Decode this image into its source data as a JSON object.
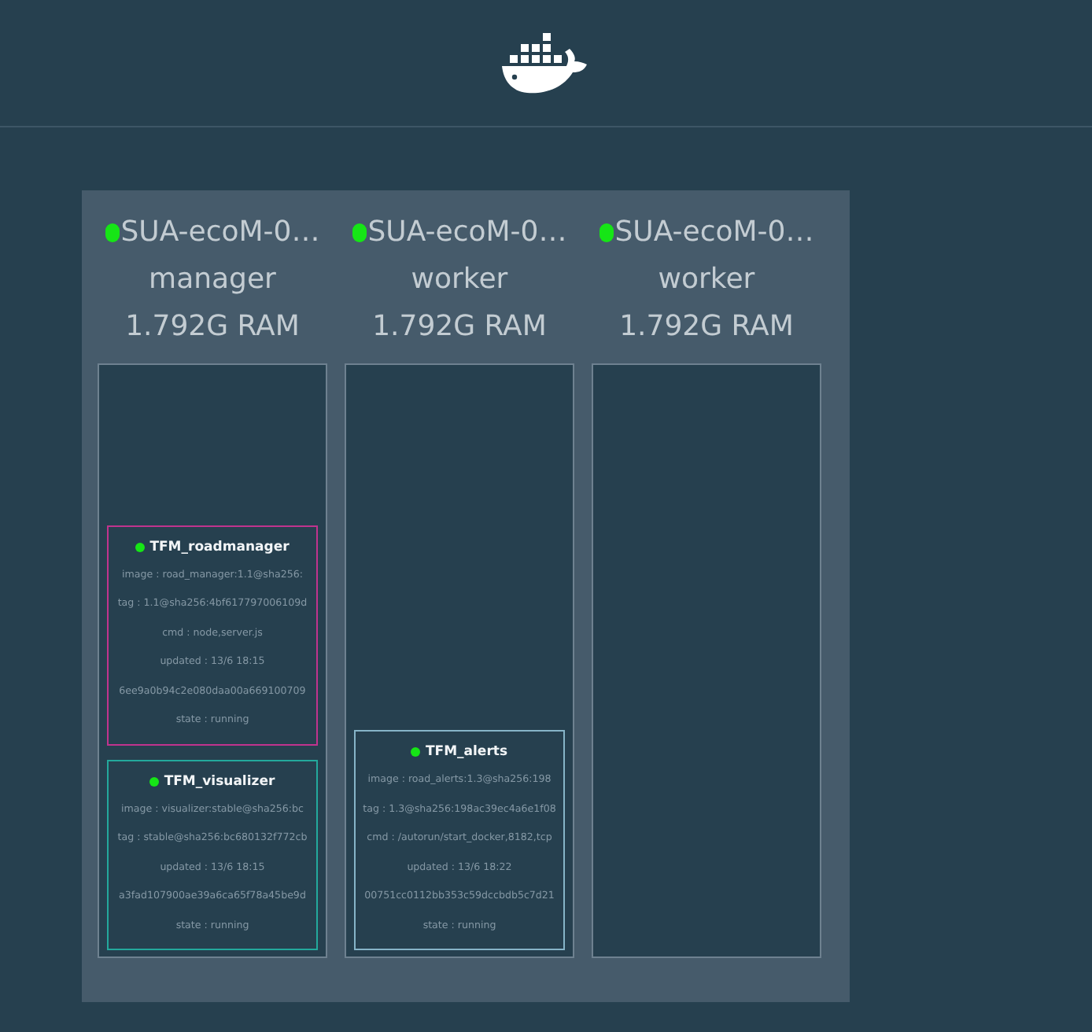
{
  "nodes": [
    {
      "name": "SUA-ecoM-0…",
      "status_dot": {
        "color": "#16e516"
      },
      "role": "manager",
      "ram": "1.792G RAM",
      "services": [
        {
          "name": "TFM_roadmanager",
          "status_dot": {
            "color": "#16e516"
          },
          "color": "#c0338e",
          "lines": [
            "image : road_manager:1.1@sha256:",
            "tag : 1.1@sha256:4bf617797006109d",
            "cmd : node,server.js",
            "updated : 13/6 18:15",
            "6ee9a0b94c2e080daa00a669100709",
            "state : running"
          ]
        },
        {
          "name": "TFM_visualizer",
          "status_dot": {
            "color": "#16e516"
          },
          "color": "#23a99c",
          "lines": [
            "image : visualizer:stable@sha256:bc",
            "tag : stable@sha256:bc680132f772cb",
            "updated : 13/6 18:15",
            "a3fad107900ae39a6ca65f78a45be9d",
            "state : running"
          ]
        }
      ]
    },
    {
      "name": "SUA-ecoM-0…",
      "status_dot": {
        "color": "#16e516"
      },
      "role": "worker",
      "ram": "1.792G RAM",
      "services": [
        {
          "name": "TFM_alerts",
          "status_dot": {
            "color": "#16e516"
          },
          "color": "#86b4c8",
          "lines": [
            "image : road_alerts:1.3@sha256:198",
            "tag : 1.3@sha256:198ac39ec4a6e1f08",
            "cmd : /autorun/start_docker,8182,tcp",
            "updated : 13/6 18:22",
            "00751cc0112bb353c59dccbdb5c7d21",
            "state : running"
          ]
        }
      ]
    },
    {
      "name": "SUA-ecoM-0…",
      "status_dot": {
        "color": "#16e516"
      },
      "role": "worker",
      "ram": "1.792G RAM"
    }
  ]
}
